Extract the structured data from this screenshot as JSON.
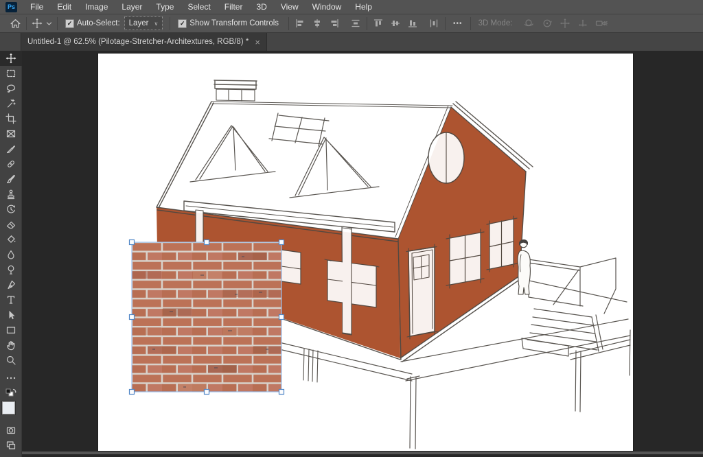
{
  "menu_bar": {
    "logo_text": "Ps",
    "items": [
      "File",
      "Edit",
      "Image",
      "Layer",
      "Type",
      "Select",
      "Filter",
      "3D",
      "View",
      "Window",
      "Help"
    ]
  },
  "options_bar": {
    "auto_select": {
      "label": "Auto-Select:",
      "checked": true,
      "value": "Layer"
    },
    "show_transform": {
      "label": "Show Transform Controls",
      "checked": true
    },
    "more_glyph": "•••",
    "mode_3d_label": "3D Mode:",
    "align_icons": [
      "align-left-edges",
      "align-horizontal-centers",
      "align-right-edges",
      "distribute-vertical-centers",
      "align-top-edges",
      "align-vertical-centers",
      "align-bottom-edges",
      "distribute-horizontal-centers"
    ],
    "mode_3d_icons": [
      "3d-orbit",
      "3d-roll",
      "3d-pan",
      "3d-slide",
      "3d-dolly-camera"
    ]
  },
  "tab_bar": {
    "active_tab": {
      "title": "Untitled-1 @ 62.5% (Pilotage-Stretcher-Architextures, RGB/8) *",
      "close_glyph": "×"
    }
  },
  "document": {
    "name": "Untitled-1",
    "zoom": "62.5%",
    "layer_name": "Pilotage-Stretcher-Architextures",
    "color_mode": "RGB/8",
    "unsaved_marker": "*"
  },
  "toolbar": {
    "selected_tool": "move-tool",
    "tools": [
      "move-tool",
      "rectangular-marquee-tool",
      "lasso-tool",
      "object-selection-tool",
      "crop-tool",
      "frame-tool",
      "eyedropper-tool",
      "healing-brush-tool",
      "brush-tool",
      "clone-stamp-tool",
      "history-brush-tool",
      "eraser-tool",
      "paint-bucket-tool",
      "blur-tool",
      "dodge-tool",
      "pen-tool",
      "type-tool",
      "path-selection-tool",
      "rectangle-tool",
      "hand-tool",
      "zoom-tool",
      "edit-toolbar",
      "default-colors",
      "foreground-background-swatches",
      "quick-mask-mode",
      "screen-mode"
    ]
  },
  "glyphs": {
    "check": "✓",
    "chevron_down": "∨"
  },
  "colors": {
    "wall_fill": "#ad5430",
    "sketch_line": "#4b4742",
    "brick": "#bc7257",
    "mortar": "#d8d2cb",
    "selection_outline": "#9cc0ef",
    "handle_border": "#4f86c6",
    "ui_bar": "#535353",
    "pasteboard": "#272727"
  }
}
